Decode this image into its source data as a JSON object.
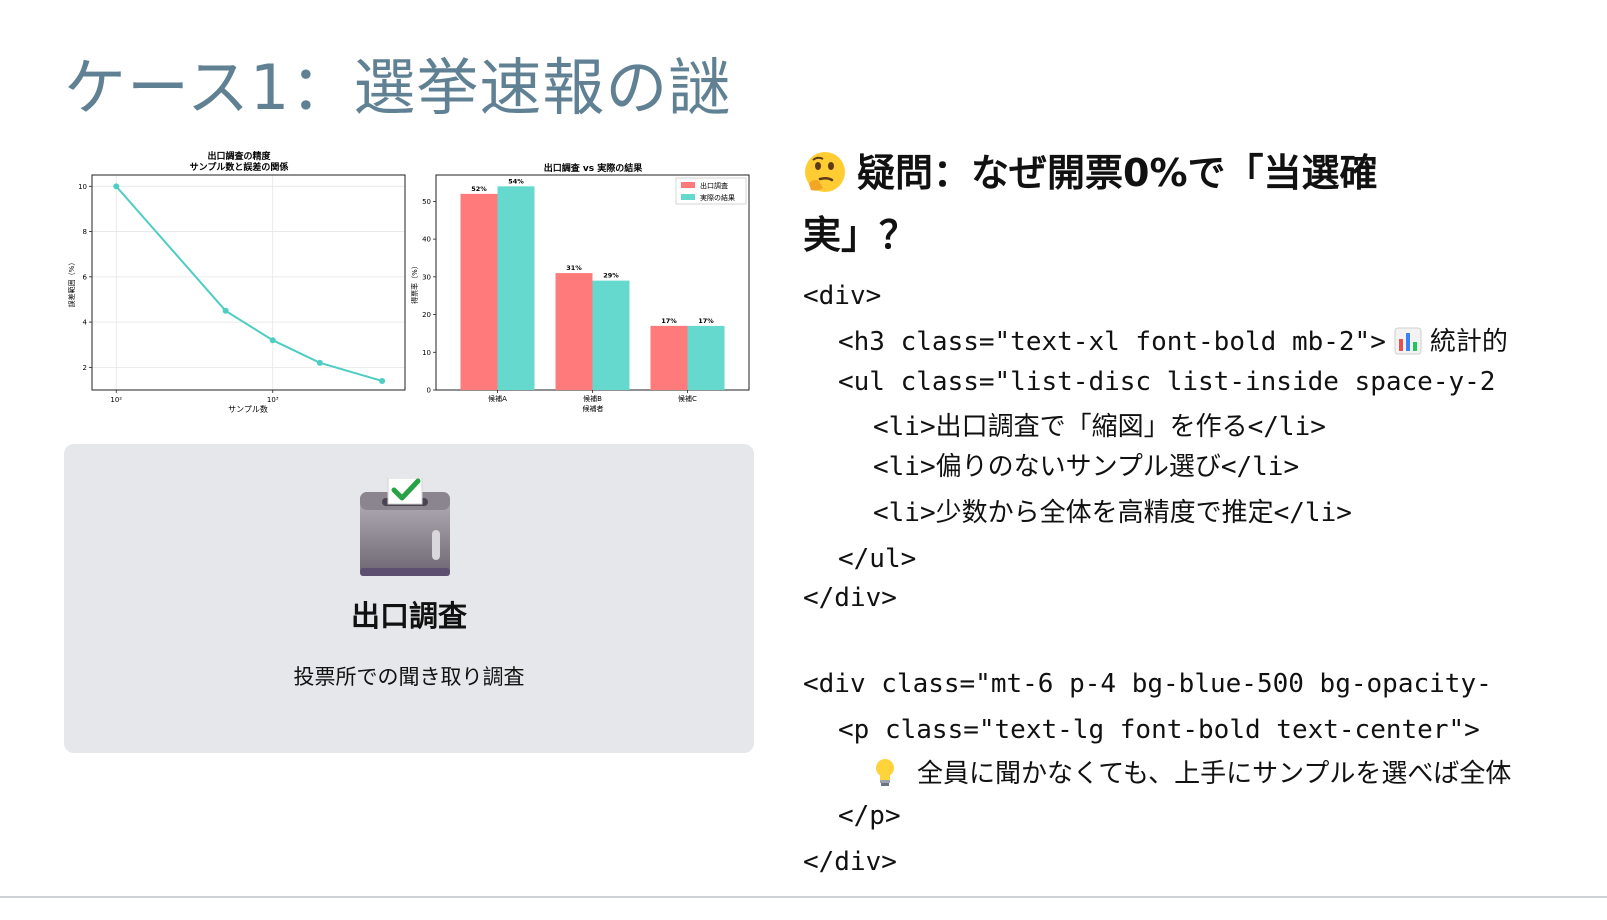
{
  "slide": {
    "title": "ケース1：選挙速報の謎"
  },
  "chart_data": [
    {
      "type": "line",
      "title": "出口調査の精度\nサンプル数と誤差の関係",
      "title_line1": "出口調査の精度",
      "title_line2": "サンプル数と誤差の関係",
      "xlabel": "サンプル数",
      "ylabel": "誤差範囲（%）",
      "x_scale": "log",
      "x": [
        100,
        500,
        1000,
        2000,
        5000
      ],
      "y": [
        10,
        4.5,
        3.2,
        2.2,
        1.4
      ],
      "xlim": [
        70,
        7000
      ],
      "ylim": [
        1,
        10.5
      ],
      "y_ticks": [
        2,
        4,
        6,
        8,
        10
      ],
      "x_ticks": [
        100,
        1000
      ],
      "x_tick_labels": [
        "10²",
        "10³"
      ],
      "grid": true,
      "color": "#4ecdc4"
    },
    {
      "type": "bar",
      "title": "出口調査 vs 実際の結果",
      "categories": [
        "候補A",
        "候補B",
        "候補C"
      ],
      "xlabel": "候補者",
      "ylabel": "得票率（%）",
      "ylim": [
        0,
        57
      ],
      "y_ticks": [
        0,
        10,
        20,
        30,
        40,
        50
      ],
      "series": [
        {
          "name": "出口調査",
          "values": [
            52,
            31,
            17
          ],
          "labels": [
            "52%",
            "31%",
            "17%"
          ],
          "color": "#ff7b7b"
        },
        {
          "name": "実際の結果",
          "values": [
            54,
            29,
            17
          ],
          "labels": [
            "54%",
            "29%",
            "17%"
          ],
          "color": "#66d9cf"
        }
      ],
      "legend": "top-right",
      "grid": false
    }
  ],
  "card": {
    "icon": "ballot-box-with-check-icon",
    "title": "出口調査",
    "description": "投票所での聞き取り調査"
  },
  "question": {
    "icon": "thinking-face-icon",
    "text": "疑問：なぜ開票0%で「当選確実」？"
  },
  "code": {
    "line1": "<div>",
    "line2_a": "<h3 class=\"text-xl font-bold mb-2\">",
    "line2_icon": "bar-chart-icon",
    "line2_b": "統計的",
    "line3": "<ul class=\"list-disc list-inside space-y-2",
    "line4": "<li>出口調査で「縮図」を作る</li>",
    "line5": "<li>偏りのないサンプル選び</li>",
    "line6": "<li>少数から全体を高精度で推定</li>",
    "line7": "</ul>",
    "line8": "</div>",
    "line9": "<div class=\"mt-6 p-4 bg-blue-500 bg-opacity-",
    "line10": "<p class=\"text-lg font-bold text-center\">",
    "line11_icon": "light-bulb-icon",
    "line11_text": "全員に聞かなくても、上手にサンプルを選べば全体",
    "line12": "</p>",
    "line13": "</div>"
  }
}
